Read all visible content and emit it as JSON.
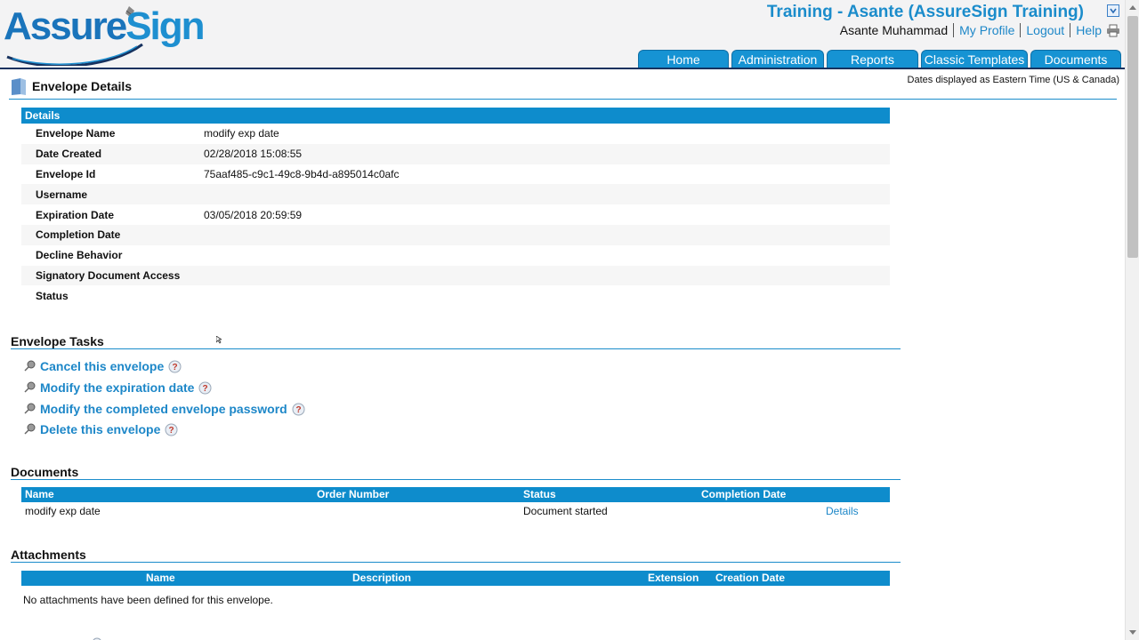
{
  "header": {
    "logo_text": "AssureSign",
    "account_title": "Training - Asante (AssureSign Training)",
    "user_name": "Asante Muhammad",
    "links": [
      "My Profile",
      "Logout",
      "Help"
    ]
  },
  "tabs": [
    "Home",
    "Administration",
    "Reports",
    "Classic Templates",
    "Documents"
  ],
  "page": {
    "title": "Envelope Details",
    "timezone_note": "Dates displayed as Eastern Time (US & Canada)"
  },
  "details": {
    "heading": "Details",
    "rows": [
      {
        "label": "Envelope Name",
        "value": "modify exp date"
      },
      {
        "label": "Date Created",
        "value": "02/28/2018 15:08:55"
      },
      {
        "label": "Envelope Id",
        "value": "75aaf485-c9c1-49c8-9b4d-a895014c0afc"
      },
      {
        "label": "Username",
        "value": ""
      },
      {
        "label": "Expiration Date",
        "value": "03/05/2018 20:59:59"
      },
      {
        "label": "Completion Date",
        "value": ""
      },
      {
        "label": "Decline Behavior",
        "value": ""
      },
      {
        "label": "Signatory Document Access",
        "value": ""
      },
      {
        "label": "Status",
        "value": ""
      }
    ]
  },
  "tasks": {
    "title": "Envelope Tasks",
    "items": [
      "Cancel this envelope",
      "Modify the expiration date",
      "Modify the completed envelope password",
      "Delete this envelope"
    ]
  },
  "documents": {
    "title": "Documents",
    "columns": [
      "Name",
      "Order Number",
      "Status",
      "Completion Date"
    ],
    "rows": [
      {
        "name": "modify exp date",
        "order_number": "",
        "status": "Document started",
        "completion_date": "",
        "action": "Details"
      }
    ]
  },
  "attachments": {
    "title": "Attachments",
    "columns": [
      "Name",
      "Description",
      "Extension",
      "Creation Date"
    ],
    "empty_message": "No attachments have been defined for this envelope."
  },
  "colors": {
    "accent": "#1b8ccb",
    "table_header": "#0e8ccc",
    "link": "#1d87c8",
    "header_rule": "#17325f"
  }
}
